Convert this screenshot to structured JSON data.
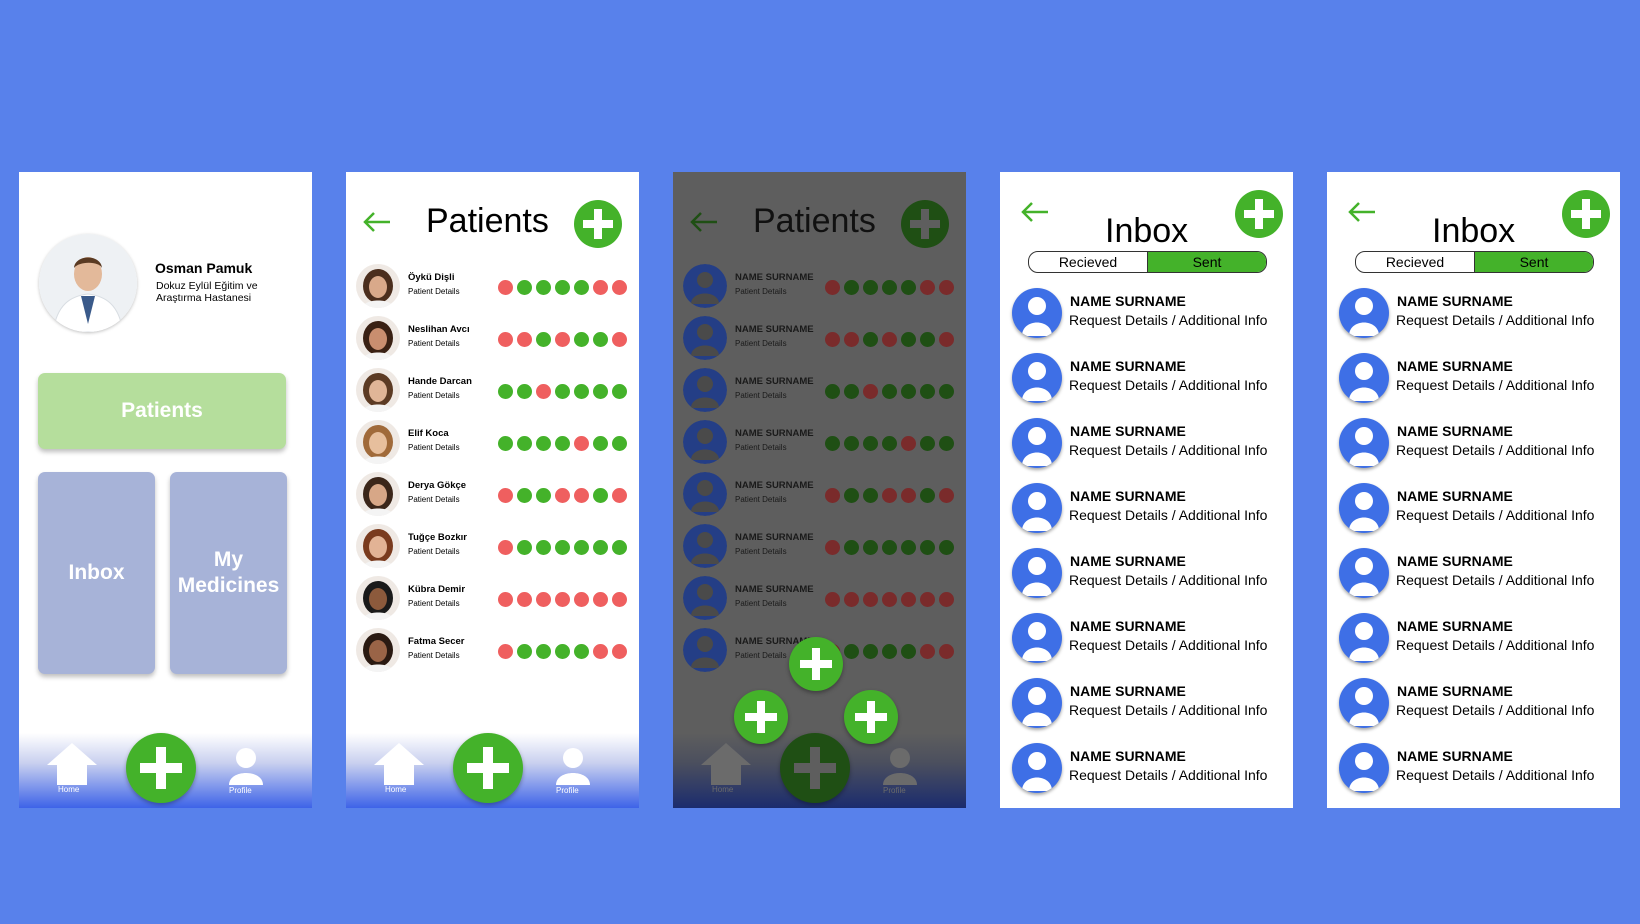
{
  "colors": {
    "background": "#5881EB",
    "green": "#44B22A",
    "red": "#EF5F5F",
    "blue": "#3E6FE6"
  },
  "home": {
    "doctor_name": "Osman Pamuk",
    "institution": "Dokuz Eylül Eğitim ve Araştırma Hastanesi",
    "tiles": {
      "patients": "Patients",
      "inbox": "Inbox",
      "medicines_line1": "My",
      "medicines_line2": "Medicines"
    }
  },
  "nav": {
    "home_label": "Home",
    "profile_label": "Profile",
    "plus_icon": "plus-icon"
  },
  "patients": {
    "title": "Patients",
    "detail_label": "Patient Details",
    "list": [
      {
        "name": "Öykü Dişli",
        "dots": [
          "r",
          "g",
          "g",
          "g",
          "g",
          "r",
          "r"
        ]
      },
      {
        "name": "Neslihan Avcı",
        "dots": [
          "r",
          "r",
          "g",
          "r",
          "g",
          "g",
          "r"
        ]
      },
      {
        "name": "Hande Darcan",
        "dots": [
          "g",
          "g",
          "r",
          "g",
          "g",
          "g",
          "g"
        ]
      },
      {
        "name": "Elif Koca",
        "dots": [
          "g",
          "g",
          "g",
          "g",
          "r",
          "g",
          "g"
        ]
      },
      {
        "name": "Derya Gökçe",
        "dots": [
          "r",
          "g",
          "g",
          "r",
          "r",
          "g",
          "r"
        ]
      },
      {
        "name": "Tuğçe Bozkır",
        "dots": [
          "r",
          "g",
          "g",
          "g",
          "g",
          "g",
          "g"
        ]
      },
      {
        "name": "Kübra Demir",
        "dots": [
          "r",
          "r",
          "r",
          "r",
          "r",
          "r",
          "r"
        ]
      },
      {
        "name": "Fatma Secer",
        "dots": [
          "r",
          "g",
          "g",
          "g",
          "g",
          "r",
          "r"
        ]
      }
    ]
  },
  "patients_overlay": {
    "title": "Patients",
    "placeholder_name": "NAME SURNAME",
    "detail_label": "Patient Details"
  },
  "inbox": {
    "title": "Inbox",
    "tabs": {
      "received": "Recieved",
      "sent": "Sent"
    },
    "item_name": "NAME SURNAME",
    "item_detail": "Request Details / Additional Info",
    "count": 8
  }
}
